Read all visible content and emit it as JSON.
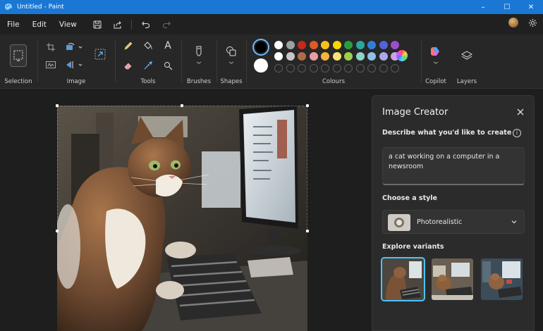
{
  "window": {
    "title": "Untitled - Paint",
    "controls": [
      "–",
      "☐",
      "✕"
    ]
  },
  "menu": {
    "file": "File",
    "edit": "Edit",
    "view": "View"
  },
  "ribbon": {
    "selection_label": "Selection",
    "image_label": "Image",
    "tools_label": "Tools",
    "brushes_label": "Brushes",
    "shapes_label": "Shapes",
    "colours_label": "Colours",
    "copilot_label": "Copilot",
    "layers_label": "Layers",
    "tools_text_icon": "A",
    "palette_row1": [
      "#ffffff",
      "#a0a0a0",
      "#c42b1c",
      "#e05a24",
      "#f7c21a",
      "#f5d800",
      "#2a9d41",
      "#2aa8a0",
      "#2f7fd8",
      "#5264d6",
      "#9b4dca"
    ],
    "palette_row2": [
      "#ffffff",
      "#c7c7c7",
      "#b06b4b",
      "#ef9aa1",
      "#f5b43a",
      "#f5e27a",
      "#9bd14a",
      "#8fd3c9",
      "#8fbfe8",
      "#a9a9ea",
      "#c7a3e6"
    ],
    "primary_colour": "#000000",
    "secondary_colour": "#ffffff"
  },
  "panel": {
    "title": "Image Creator",
    "describe_label": "Describe what you'd like to create",
    "prompt_text": "a cat working on a computer in a newsroom",
    "style_label": "Choose a style",
    "style_value": "Photorealistic",
    "variants_label": "Explore variants"
  }
}
